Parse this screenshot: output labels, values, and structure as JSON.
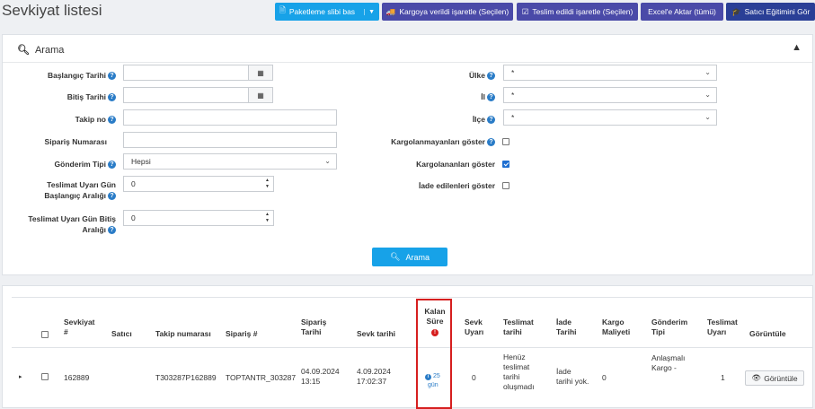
{
  "page": {
    "title": "Sevkiyat listesi"
  },
  "toolbar": {
    "paket_label": "Paketleme slibi bas",
    "kargo_label": "Kargoya verildi işaretle (Seçilen)",
    "teslim_label": "Teslim edildi işaretle (Seçilen)",
    "excel_label": "Excel'e Aktar (tümü)",
    "egitim_label": "Satıcı Eğitimini Gör"
  },
  "search": {
    "title": "Arama",
    "button_label": "Arama",
    "left": {
      "baslangic_label": "Başlangıç Tarihi",
      "bitis_label": "Bitiş Tarihi",
      "takip_label": "Takip no",
      "siparis_label": "Sipariş Numarası",
      "gonderim_label": "Gönderim Tipi",
      "gonderim_value": "Hepsi",
      "uyari_bas_label_1": "Teslimat Uyarı Gün",
      "uyari_bas_label_2": "Başlangıç Aralığı",
      "uyari_bas_value": "0",
      "uyari_bit_label_1": "Teslimat Uyarı Gün Bitiş",
      "uyari_bit_label_2": "Aralığı",
      "uyari_bit_value": "0"
    },
    "right": {
      "ulke_label": "Ülke",
      "ulke_value": "*",
      "il_label": "İl",
      "il_value": "*",
      "ilce_label": "İlçe",
      "ilce_value": "*",
      "kargolanmayan_label": "Kargolanmayanları göster",
      "kargolanan_label": "Kargolananları göster",
      "iade_label": "İade edilenleri göster"
    }
  },
  "table": {
    "headers": {
      "sevkiyat_1": "Sevkiyat",
      "sevkiyat_2": "#",
      "satici": "Satıcı",
      "takip": "Takip numarası",
      "siparis": "Sipariş #",
      "siparis_tarihi_1": "Sipariş",
      "siparis_tarihi_2": "Tarihi",
      "sevk_tarihi": "Sevk tarihi",
      "kalan_1": "Kalan",
      "kalan_2": "Süre",
      "sevk_uyari_1": "Sevk",
      "sevk_uyari_2": "Uyarı",
      "teslimat_1": "Teslimat",
      "teslimat_2": "tarihi",
      "iade_1": "İade",
      "iade_2": "Tarihi",
      "kargo_1": "Kargo",
      "kargo_2": "Maliyeti",
      "gonderim_1": "Gönderim",
      "gonderim_2": "Tipi",
      "teslimat_uyari_1": "Teslimat",
      "teslimat_uyari_2": "Uyarı",
      "goruntule": "Görüntüle"
    },
    "row": {
      "sevkiyat": "162889",
      "satici": "",
      "takip": "T303287P162889",
      "siparis": "TOPTANTR_303287",
      "siparis_tarihi_1": "04.09.2024",
      "siparis_tarihi_2": "13:15",
      "sevk_tarihi_1": "4.09.2024",
      "sevk_tarihi_2": "17:02:37",
      "kalan_1": "25",
      "kalan_2": "gün",
      "sevk_uyari": "0",
      "teslimat_1": "Henüz",
      "teslimat_2": "teslimat",
      "teslimat_3": "tarihi",
      "teslimat_4": "oluşmadı",
      "iade_1": "İade",
      "iade_2": "tarihi yok.",
      "kargo": "0",
      "gonderim_1": "Anlaşmalı",
      "gonderim_2": "Kargo -",
      "teslimat_uyari": "1",
      "goruntule_label": "Görüntüle"
    }
  },
  "colors": {
    "cyan": "#17a2e8",
    "indigo": "#4a4aa8",
    "navy": "#2a3f96",
    "alert": "#d61f1f"
  }
}
